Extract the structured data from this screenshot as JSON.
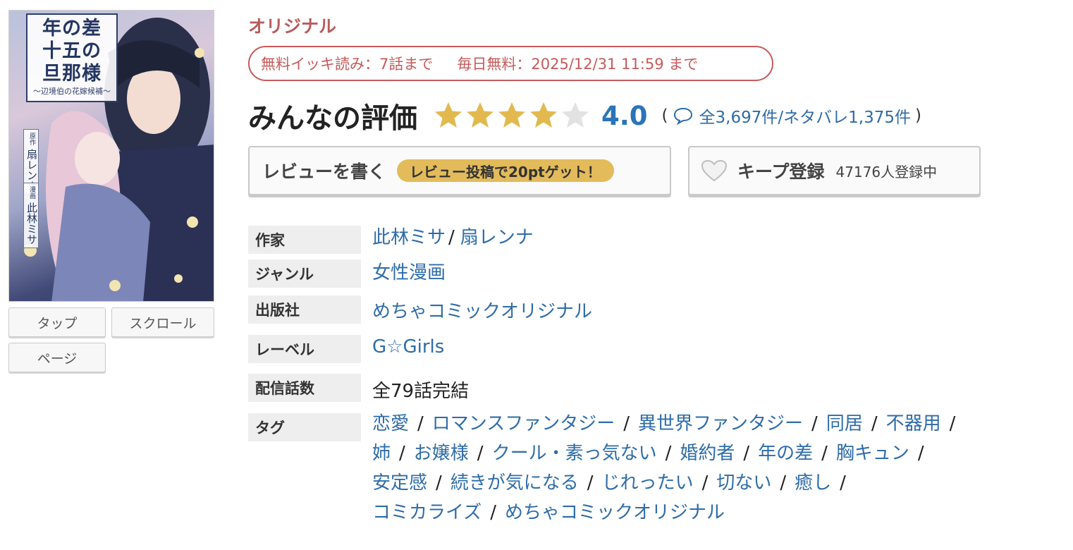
{
  "cover": {
    "title": "年の差\n十五の\n旦那様",
    "subtitle": "〜辺境伯の花嫁候補〜",
    "credits": [
      {
        "role": "原作",
        "name": "扇レンナ"
      },
      {
        "role": "漫画",
        "name": "此林ミサ"
      }
    ]
  },
  "view_modes": [
    "タップ",
    "スクロール",
    "ページ"
  ],
  "badge_original": "オリジナル",
  "free_info": {
    "ikki": "無料イッキ読み：7話まで",
    "daily": "毎日無料：2025/12/31 11:59 まで"
  },
  "rating": {
    "title": "みんなの評価",
    "value": "4.0",
    "stars_filled": 4,
    "stars_total": 5,
    "open_paren": "(",
    "counts": "全3,697件/ネタバレ1,375件",
    "close_paren": ")"
  },
  "review_button": {
    "label": "レビューを書く",
    "promo": "レビュー投稿で20ptゲット！"
  },
  "keep_button": {
    "label": "キープ登録",
    "count": "47176人登録中"
  },
  "info": {
    "author_label": "作家",
    "authors": [
      "此林ミサ",
      "扇レンナ"
    ],
    "author_sep": "/",
    "genre_label": "ジャンル",
    "genre": "女性漫画",
    "publisher_label": "出版社",
    "publisher": "めちゃコミックオリジナル",
    "label_label": "レーベル",
    "label": "G☆Girls",
    "episodes_label": "配信話数",
    "episodes": "全79話完結",
    "tags_label": "タグ"
  },
  "tag_sep": "/",
  "tag_lines": [
    [
      "恋愛",
      "ロマンスファンタジー",
      "異世界ファンタジー",
      "同居",
      "不器用"
    ],
    [
      "姉",
      "お嬢様",
      "クール・素っ気ない",
      "婚約者",
      "年の差",
      "胸キュン"
    ],
    [
      "安定感",
      "続きが気になる",
      "じれったい",
      "切ない",
      "癒し"
    ],
    [
      "コミカライズ",
      "めちゃコミックオリジナル"
    ]
  ],
  "colors": {
    "original": "#b85c5c",
    "link": "#2e6ca8",
    "star_filled": "#e2b94f",
    "star_empty": "#e2e2e2",
    "promo": "#e3bb5b"
  },
  "icons": [
    "star-icon",
    "speech-bubble-icon",
    "heart-icon"
  ]
}
